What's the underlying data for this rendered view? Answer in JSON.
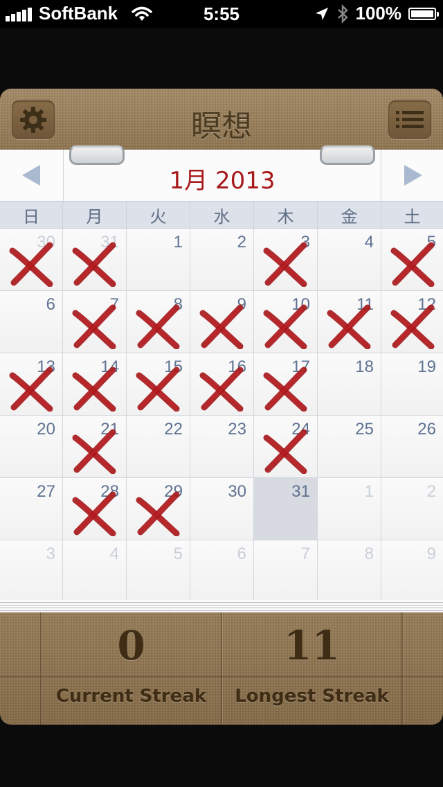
{
  "status_bar": {
    "carrier": "SoftBank",
    "time": "5:55",
    "battery": "100%"
  },
  "header": {
    "title": "瞑想",
    "settings_icon": "gear-icon",
    "menu_icon": "list-icon"
  },
  "calendar": {
    "month_title": "1月 2013",
    "prev_icon": "arrow-left-icon",
    "next_icon": "arrow-right-icon",
    "weekdays": [
      "日",
      "月",
      "火",
      "水",
      "木",
      "金",
      "土"
    ],
    "days": [
      {
        "n": "30",
        "other": true,
        "x": true
      },
      {
        "n": "31",
        "other": true,
        "x": true
      },
      {
        "n": "1"
      },
      {
        "n": "2"
      },
      {
        "n": "3",
        "x": true
      },
      {
        "n": "4"
      },
      {
        "n": "5",
        "x": true
      },
      {
        "n": "6"
      },
      {
        "n": "7",
        "x": true
      },
      {
        "n": "8",
        "x": true
      },
      {
        "n": "9",
        "x": true
      },
      {
        "n": "10",
        "x": true
      },
      {
        "n": "11",
        "x": true
      },
      {
        "n": "12",
        "x": true
      },
      {
        "n": "13",
        "x": true
      },
      {
        "n": "14",
        "x": true
      },
      {
        "n": "15",
        "x": true
      },
      {
        "n": "16",
        "x": true
      },
      {
        "n": "17",
        "x": true
      },
      {
        "n": "18"
      },
      {
        "n": "19"
      },
      {
        "n": "20"
      },
      {
        "n": "21",
        "x": true
      },
      {
        "n": "22"
      },
      {
        "n": "23"
      },
      {
        "n": "24",
        "x": true
      },
      {
        "n": "25"
      },
      {
        "n": "26"
      },
      {
        "n": "27"
      },
      {
        "n": "28",
        "x": true
      },
      {
        "n": "29",
        "x": true
      },
      {
        "n": "30"
      },
      {
        "n": "31",
        "today": true
      },
      {
        "n": "1",
        "other": true
      },
      {
        "n": "2",
        "other": true
      },
      {
        "n": "3",
        "other": true
      },
      {
        "n": "4",
        "other": true
      },
      {
        "n": "5",
        "other": true
      },
      {
        "n": "6",
        "other": true
      },
      {
        "n": "7",
        "other": true
      },
      {
        "n": "8",
        "other": true
      },
      {
        "n": "9",
        "other": true
      }
    ]
  },
  "stats": {
    "current_value": "0",
    "current_label": "Current Streak",
    "longest_value": "11",
    "longest_label": "Longest Streak"
  },
  "colors": {
    "accent_red": "#a8191b",
    "day_number": "#5f7291"
  }
}
